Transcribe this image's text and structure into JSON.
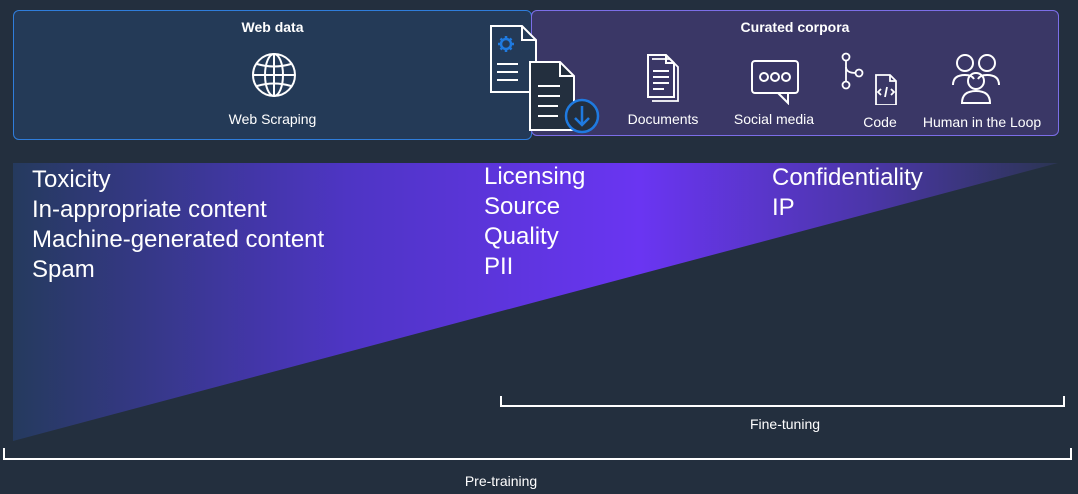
{
  "web_data": {
    "title": "Web data",
    "items": [
      {
        "label": "Web Scraping",
        "icon": "globe-icon"
      }
    ]
  },
  "curated_corpora": {
    "title": "Curated corpora",
    "items": [
      {
        "label": "Documents",
        "icon": "documents-icon"
      },
      {
        "label": "Social media",
        "icon": "chat-bubble-icon"
      },
      {
        "label": "Code",
        "icon": "code-file-icon"
      },
      {
        "label": "Human in the Loop",
        "icon": "people-icon"
      }
    ]
  },
  "transfer_icon": "document-download-icon",
  "concerns": {
    "pretraining": [
      "Toxicity",
      "In-appropriate content",
      "Machine-generated content",
      "Spam"
    ],
    "data_sourcing": [
      "Licensing",
      "Source",
      "Quality",
      "PII"
    ],
    "curated": [
      "Confidentiality",
      "IP"
    ]
  },
  "stages": {
    "fine_tuning": "Fine-tuning",
    "pre_training": "Pre-training"
  },
  "colors": {
    "background": "#232f3e",
    "web_box_fill": "#243a57",
    "web_box_border": "#2f7ddb",
    "curated_box_fill": "#3a3766",
    "curated_box_border": "#7c6ee8",
    "wedge_start": "#253a5e",
    "wedge_mid": "#6a35f2",
    "wedge_end": "#2b3553",
    "accent_blue": "#1f7ae0"
  }
}
